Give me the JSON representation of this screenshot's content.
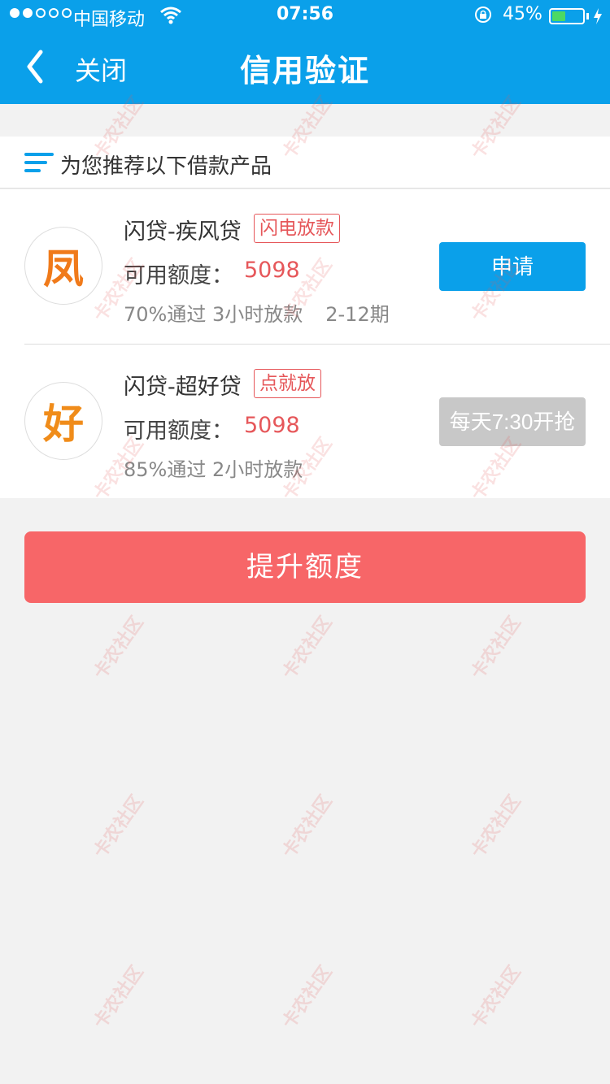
{
  "status_bar": {
    "carrier": "中国移动",
    "time": "07:56",
    "battery_percent": "45%",
    "battery_level": 0.45
  },
  "nav": {
    "back_icon": "chevron-left-icon",
    "close_label": "关闭",
    "title": "信用验证"
  },
  "recommend": {
    "icon": "list-icon",
    "title": "为您推荐以下借款产品"
  },
  "products": [
    {
      "name": "闪贷-疾风贷",
      "tag": "闪电放款",
      "logo_char": "凤",
      "logo_color": "#f07a1a",
      "quota_label": "可用额度：",
      "quota_value": "5098",
      "meta": [
        "70%通过 3小时放款",
        "2-12期"
      ],
      "button": "申请",
      "button_state": "enabled"
    },
    {
      "name": "闪贷-超好贷",
      "tag": "点就放",
      "logo_char": "好",
      "logo_color": "#f08c1a",
      "quota_label": "可用额度：",
      "quota_value": "5098",
      "meta": [
        "85%通过 2小时放款"
      ],
      "button": "每天7:30开抢",
      "button_state": "disabled"
    }
  ],
  "main_button": "提升额度",
  "watermark_text": "卡农社区",
  "colors": {
    "primary": "#0aa0ea",
    "accent_red": "#e6575a",
    "main_button": "#f76668",
    "disabled": "#c8c8c8"
  }
}
